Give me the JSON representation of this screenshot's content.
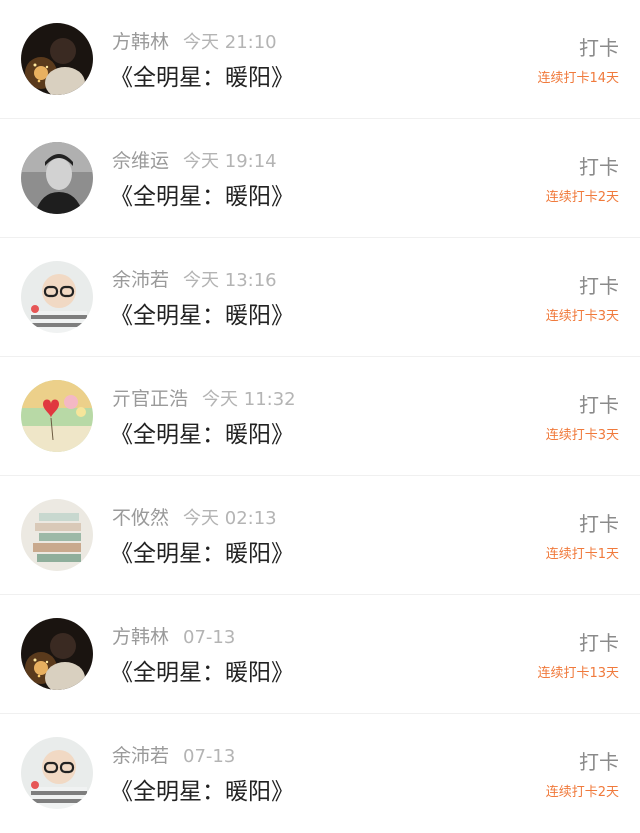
{
  "colors": {
    "background": "#ffffff",
    "name_text": "#9a9a9a",
    "time_text": "#b4b4b4",
    "title_text": "#222222",
    "action_text": "#8a8a8a",
    "streak_text": "#f07a3c",
    "divider": "#f0f0f0"
  },
  "checkins": [
    {
      "avatar": "avatar-night-sparkler",
      "name": "方韩林",
      "time": "今天 21:10",
      "title": "《全明星：暖阳》",
      "action": "打卡",
      "streak": "连续打卡14天"
    },
    {
      "avatar": "avatar-bw-portrait",
      "name": "佘维运",
      "time": "今天 19:14",
      "title": "《全明星：暖阳》",
      "action": "打卡",
      "streak": "连续打卡2天"
    },
    {
      "avatar": "avatar-glasses-kid",
      "name": "余沛若",
      "time": "今天 13:16",
      "title": "《全明星：暖阳》",
      "action": "打卡",
      "streak": "连续打卡3天"
    },
    {
      "avatar": "avatar-heart-balloon",
      "name": "亓官正浩",
      "time": "今天 11:32",
      "title": "《全明星：暖阳》",
      "action": "打卡",
      "streak": "连续打卡3天"
    },
    {
      "avatar": "avatar-book-stack",
      "name": "不攸然",
      "time": "今天 02:13",
      "title": "《全明星：暖阳》",
      "action": "打卡",
      "streak": "连续打卡1天"
    },
    {
      "avatar": "avatar-night-sparkler",
      "name": "方韩林",
      "time": "07-13",
      "title": "《全明星：暖阳》",
      "action": "打卡",
      "streak": "连续打卡13天"
    },
    {
      "avatar": "avatar-glasses-kid",
      "name": "余沛若",
      "time": "07-13",
      "title": "《全明星：暖阳》",
      "action": "打卡",
      "streak": "连续打卡2天"
    }
  ]
}
